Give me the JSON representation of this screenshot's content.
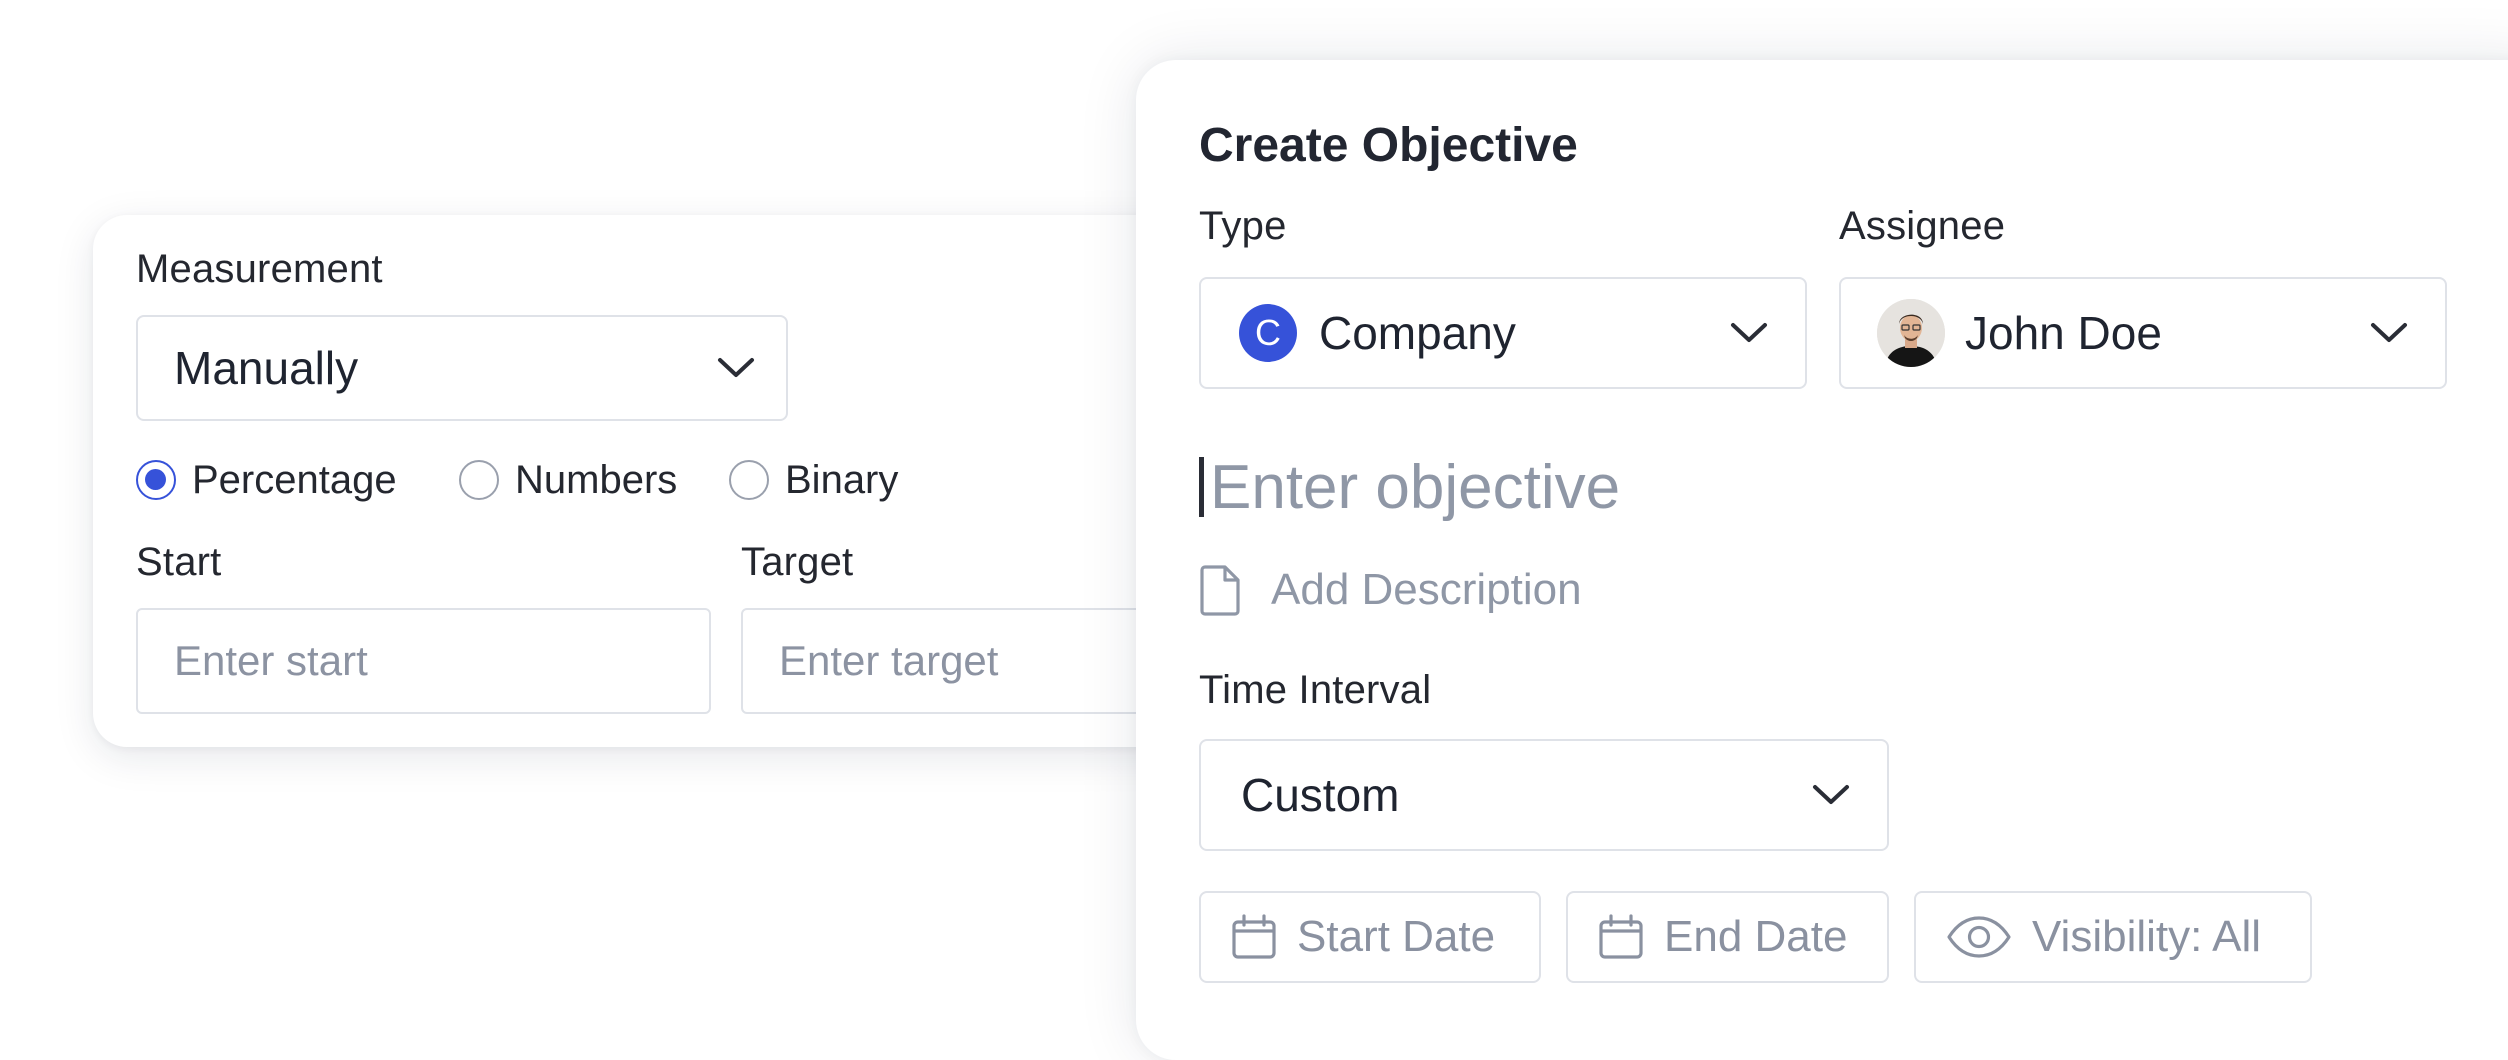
{
  "measurement_card": {
    "label": "Measurement",
    "method_select": {
      "value": "Manually"
    },
    "radio_options": [
      {
        "label": "Percentage",
        "checked": true
      },
      {
        "label": "Numbers",
        "checked": false
      },
      {
        "label": "Binary",
        "checked": false
      }
    ],
    "start": {
      "label": "Start",
      "placeholder": "Enter start"
    },
    "target": {
      "label": "Target",
      "placeholder": "Enter target"
    }
  },
  "objective_card": {
    "title": "Create Objective",
    "type": {
      "label": "Type",
      "value": "Company",
      "avatar_letter": "C"
    },
    "assignee": {
      "label": "Assignee",
      "value": "John Doe"
    },
    "objective_placeholder": "Enter objective",
    "add_description": "Add Description",
    "time_interval": {
      "label": "Time Interval",
      "value": "Custom"
    },
    "actions": {
      "start_date": "Start Date",
      "end_date": "End Date",
      "visibility": "Visibility: All"
    }
  },
  "icons": {
    "dropdown": "chevron-down-icon",
    "description": "file-icon",
    "date": "calendar-icon",
    "visibility": "eye-icon"
  },
  "colors": {
    "accent": "#3652d9",
    "placeholder": "#8f97a6",
    "border": "#dfe2e8"
  }
}
